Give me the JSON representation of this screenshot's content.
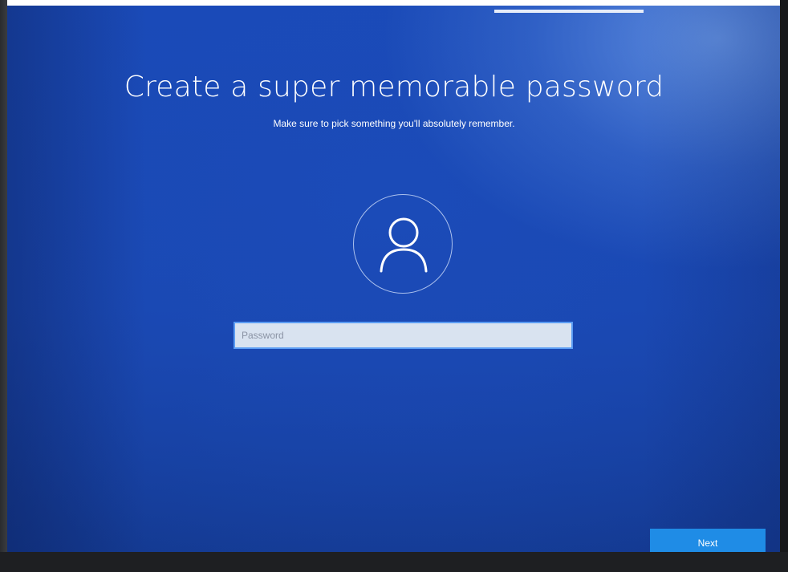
{
  "setup": {
    "title": "Create a super memorable password",
    "subtitle": "Make sure to pick something you'll absolutely remember.",
    "avatar_icon": "user-icon"
  },
  "password": {
    "placeholder": "Password",
    "value": ""
  },
  "footer": {
    "next_label": "Next"
  },
  "colors": {
    "background": "#1a4ab8",
    "accent": "#1f8ce6",
    "field_border": "#5b9cf3"
  }
}
